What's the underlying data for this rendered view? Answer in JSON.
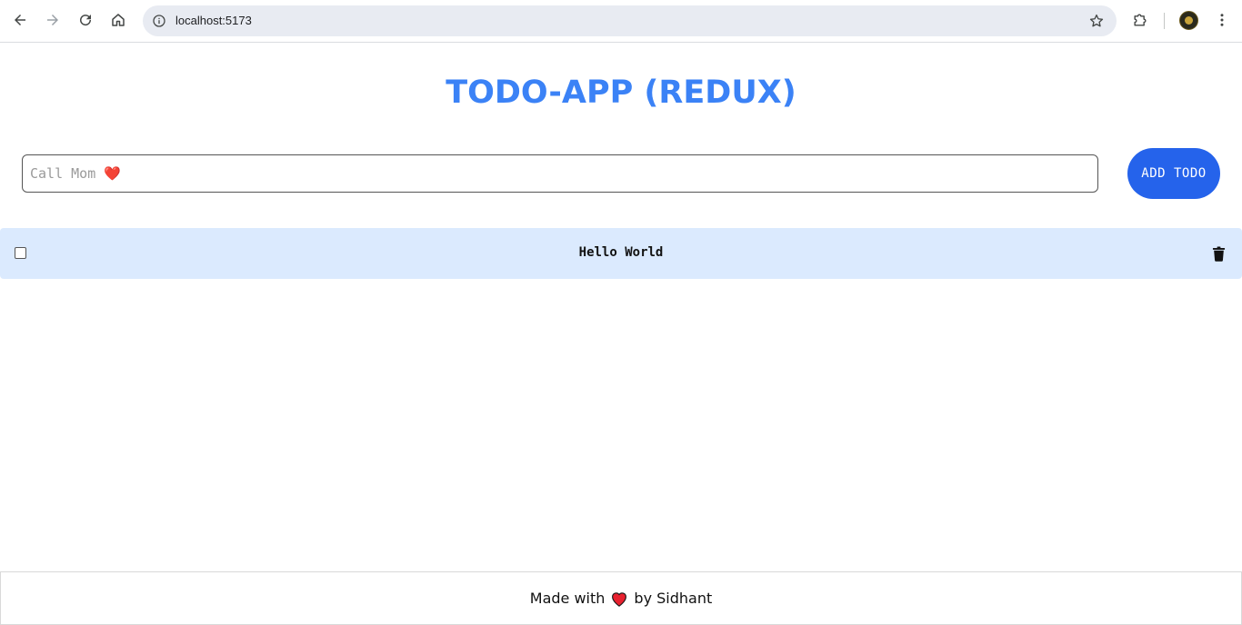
{
  "browser": {
    "url": "localhost:5173",
    "icons": {
      "back": "back-arrow-icon",
      "forward": "forward-arrow-icon",
      "reload": "reload-icon",
      "home": "home-icon",
      "info": "info-icon",
      "bookmark": "star-icon",
      "extensions": "puzzle-icon",
      "profile": "avatar",
      "menu": "kebab-menu-icon"
    }
  },
  "app": {
    "title": "TODO-APP (REDUX)",
    "input": {
      "placeholder": "Call Mom ❤️",
      "value": ""
    },
    "add_button_label": "ADD TODO",
    "todos": [
      {
        "text": "Hello World",
        "completed": false
      }
    ],
    "footer": {
      "prefix": "Made with",
      "suffix": "by Sidhant"
    },
    "colors": {
      "title": "#3b82f6",
      "button": "#2563eb",
      "row_bg": "#dbeafe",
      "heart": "#e8212f"
    }
  }
}
